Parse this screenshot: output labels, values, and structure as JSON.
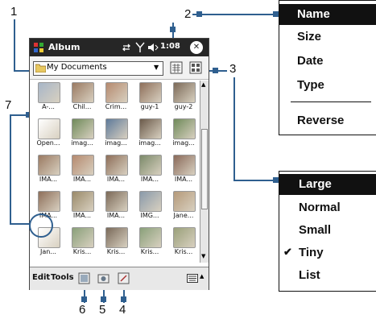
{
  "callouts": [
    "1",
    "2",
    "3",
    "4",
    "5",
    "6",
    "7"
  ],
  "window": {
    "title": "Album",
    "time": "1:08",
    "close_glyph": "✕"
  },
  "folder": {
    "value": "My Documents"
  },
  "thumbs": [
    {
      "label": "A-...",
      "color": "#a7b6c8"
    },
    {
      "label": "Chil...",
      "color": "#9a7a62"
    },
    {
      "label": "Crim...",
      "color": "#b58a6f"
    },
    {
      "label": "guy-1",
      "color": "#8e6f5a"
    },
    {
      "label": "guy-2",
      "color": "#7c6a58"
    },
    {
      "label": "Open...",
      "color": "#ffffff"
    },
    {
      "label": "imag...",
      "color": "#6f8a5a"
    },
    {
      "label": "imag...",
      "color": "#5e7a9a"
    },
    {
      "label": "imag...",
      "color": "#6b5a4a"
    },
    {
      "label": "imag...",
      "color": "#6f8a5a"
    },
    {
      "label": "IMA...",
      "color": "#9a7a62"
    },
    {
      "label": "IMA...",
      "color": "#b58a6f"
    },
    {
      "label": "IMA...",
      "color": "#8e6f5a"
    },
    {
      "label": "IMA...",
      "color": "#7c8a6a"
    },
    {
      "label": "IMA...",
      "color": "#8a6a5a"
    },
    {
      "label": "IMA...",
      "color": "#8e6f5a"
    },
    {
      "label": "IMA...",
      "color": "#9a8a6a"
    },
    {
      "label": "IMA...",
      "color": "#7c6a58"
    },
    {
      "label": "IMG...",
      "color": "#8a9aaa"
    },
    {
      "label": "Jane...",
      "color": "#b59a7a"
    },
    {
      "label": "Jan...",
      "color": "#ffffff"
    },
    {
      "label": "Kris...",
      "color": "#8aa07a"
    },
    {
      "label": "Kris...",
      "color": "#7a6a5a"
    },
    {
      "label": "Kris...",
      "color": "#8aa07a"
    },
    {
      "label": "Kris...",
      "color": "#9aa07a"
    },
    {
      "label": "",
      "color": "#8a7a6a"
    },
    {
      "label": "",
      "color": "#6a7aa0"
    },
    {
      "label": "",
      "color": "#8a6a5a"
    },
    {
      "label": "",
      "color": "#9a8a7a"
    },
    {
      "label": "",
      "color": "#b08a7a"
    }
  ],
  "bottom": {
    "edit": "Edit",
    "tools": "Tools"
  },
  "sort_menu": {
    "items": [
      "Name",
      "Size",
      "Date",
      "Type",
      "Reverse"
    ],
    "selected": "Name"
  },
  "view_menu": {
    "items": [
      "Large",
      "Normal",
      "Small",
      "Tiny",
      "List"
    ],
    "selected": "Large",
    "checked": "Tiny",
    "check_glyph": "✔"
  }
}
